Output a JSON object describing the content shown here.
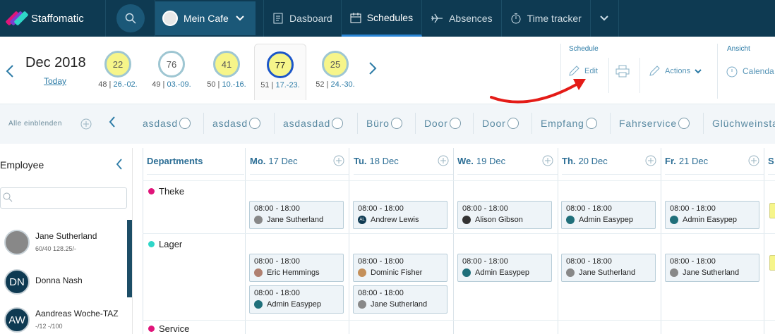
{
  "app": {
    "brand": "Staffomatic",
    "location": "Mein Cafe",
    "nav": [
      {
        "label": "Dasboard",
        "icon": "dashboard-icon"
      },
      {
        "label": "Schedules",
        "icon": "schedules-icon",
        "active": true
      },
      {
        "label": "Absences",
        "icon": "plane-icon"
      },
      {
        "label": "Time tracker",
        "icon": "clock-icon"
      }
    ]
  },
  "weekbar": {
    "month": "Dec 2018",
    "today": "Today",
    "weeks": [
      {
        "count": "22",
        "num": "48",
        "range": "26.-02.",
        "style": "yellow"
      },
      {
        "count": "76",
        "num": "49",
        "range": "03.-09.",
        "style": "white"
      },
      {
        "count": "41",
        "num": "50",
        "range": "10.-16.",
        "style": "yellow"
      },
      {
        "count": "77",
        "num": "51",
        "range": "17.-23.",
        "style": "sel"
      },
      {
        "count": "25",
        "num": "52",
        "range": "24.-30.",
        "style": "yellow"
      }
    ],
    "schedule_header": "Schedule",
    "edit": "Edit",
    "actions": "Actions",
    "ansicht_header": "Ansicht",
    "calendar": "Calenda"
  },
  "deptbar": {
    "show_all": "Alle einblenden",
    "chips": [
      "asdasd",
      "asdasd",
      "asdasdad",
      "Büro",
      "Door",
      "Door",
      "Empfang",
      "Fahrservice",
      "Glüchweinsta"
    ]
  },
  "employees": {
    "title": "Employee",
    "search_placeholder": "",
    "list": [
      {
        "name": "Jane Sutherland",
        "sub": "60/40 128.25/-",
        "initials": "",
        "color": "#888888"
      },
      {
        "name": "Donna Nash",
        "sub": "",
        "initials": "DN",
        "color": "#0e3a52"
      },
      {
        "name": "Aandreas Woche-TAZ",
        "sub": "-/12 -/100",
        "initials": "AW",
        "color": "#0e3a52"
      }
    ]
  },
  "schedule": {
    "departments_header": "Departments",
    "days": [
      {
        "day": "Mo.",
        "date": "17 Dec"
      },
      {
        "day": "Tu.",
        "date": "18 Dec"
      },
      {
        "day": "We.",
        "date": "19 Dec"
      },
      {
        "day": "Th.",
        "date": "20 Dec"
      },
      {
        "day": "Fr.",
        "date": "21 Dec"
      },
      {
        "day": "S",
        "date": ""
      }
    ],
    "departments": [
      {
        "name": "Theke",
        "color": "#e0157a"
      },
      {
        "name": "Lager",
        "color": "#2fd6c8"
      },
      {
        "name": "Service",
        "color": "#e0157a"
      }
    ],
    "shifts": {
      "theke": [
        {
          "time": "08:00 - 18:00",
          "emp": "Jane Sutherland",
          "av": "#888888",
          "ini": ""
        },
        {
          "time": "08:00 - 18:00",
          "emp": "Andrew Lewis",
          "av": "#0e3a52",
          "ini": "AL"
        },
        {
          "time": "08:00 - 18:00",
          "emp": "Alison Gibson",
          "av": "#333333",
          "ini": ""
        },
        {
          "time": "08:00 - 18:00",
          "emp": "Admin Easypep",
          "av": "#1f6f7a",
          "ini": ""
        },
        {
          "time": "08:00 - 18:00",
          "emp": "Admin Easypep",
          "av": "#1f6f7a",
          "ini": ""
        }
      ],
      "lager1": [
        {
          "time": "08:00 - 18:00",
          "emp": "Eric Hemmings",
          "av": "#b08070",
          "ini": ""
        },
        {
          "time": "08:00 - 18:00",
          "emp": "Dominic Fisher",
          "av": "#c4905a",
          "ini": ""
        },
        {
          "time": "08:00 - 18:00",
          "emp": "Admin Easypep",
          "av": "#1f6f7a",
          "ini": ""
        },
        {
          "time": "08:00 - 18:00",
          "emp": "Jane Sutherland",
          "av": "#888888",
          "ini": ""
        },
        {
          "time": "08:00 - 18:00",
          "emp": "Jane Sutherland",
          "av": "#888888",
          "ini": ""
        }
      ],
      "lager2": [
        {
          "time": "08:00 - 18:00",
          "emp": "Admin Easypep",
          "av": "#1f6f7a",
          "ini": ""
        },
        {
          "time": "08:00 - 18:00",
          "emp": "Jane Sutherland",
          "av": "#888888",
          "ini": ""
        }
      ]
    }
  }
}
